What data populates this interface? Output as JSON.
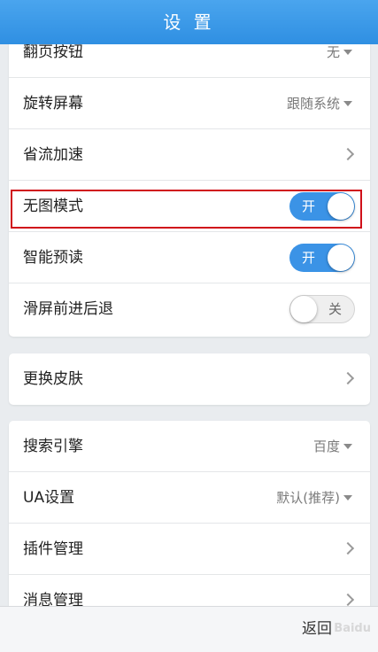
{
  "header": {
    "title": "设 置"
  },
  "settings": {
    "page_turn_button": {
      "label": "翻页按钮",
      "value": "无"
    },
    "rotate_screen": {
      "label": "旋转屏幕",
      "value": "跟随系统"
    },
    "data_saving": {
      "label": "省流加速"
    },
    "no_image_mode": {
      "label": "无图模式",
      "toggle": "开",
      "state": "on"
    },
    "smart_preload": {
      "label": "智能预读",
      "toggle": "开",
      "state": "on"
    },
    "swipe_nav": {
      "label": "滑屏前进后退",
      "toggle": "关",
      "state": "off"
    },
    "change_skin": {
      "label": "更换皮肤"
    },
    "search_engine": {
      "label": "搜索引擎",
      "value": "百度"
    },
    "ua_settings": {
      "label": "UA设置",
      "value": "默认(推荐)"
    },
    "plugin_manage": {
      "label": "插件管理"
    },
    "message_manage": {
      "label": "消息管理"
    }
  },
  "footer": {
    "back_label": "返回"
  },
  "colors": {
    "accent": "#3b93e6",
    "highlight_border": "#d0101a"
  }
}
